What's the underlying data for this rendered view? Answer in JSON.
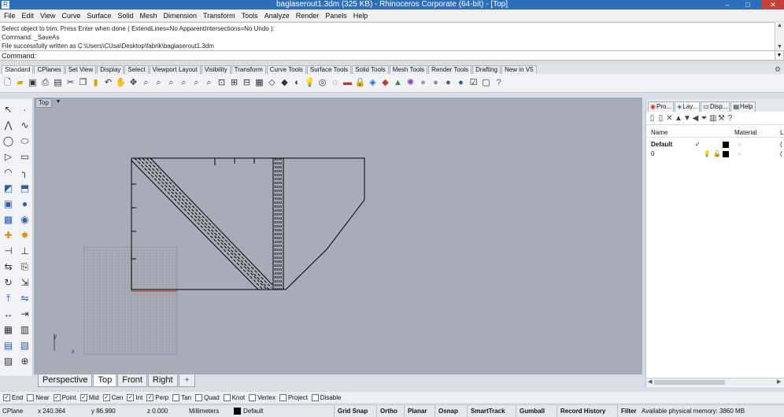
{
  "titlebar": {
    "title": "baglaserout1.3dm (325 KB) - Rhinoceros Corporate (64-bit) - [Top]",
    "min": "–",
    "max": "□",
    "close": "✕"
  },
  "menu": [
    "File",
    "Edit",
    "View",
    "Curve",
    "Surface",
    "Solid",
    "Mesh",
    "Dimension",
    "Transform",
    "Tools",
    "Analyze",
    "Render",
    "Panels",
    "Help"
  ],
  "history": [
    "Select object to trim. Press Enter when done ( ExtendLines=No  ApparentIntersections=No  Undo ):",
    "Command: _SaveAs",
    "File successfully written as C:\\Users\\CUsa\\Desktop\\fabrik\\baglaserout1.3dm"
  ],
  "command": {
    "label": "Command:",
    "value": ""
  },
  "toolbar_tabs": [
    "Standard",
    "CPlanes",
    "Set View",
    "Display",
    "Select",
    "Viewport Layout",
    "Visibility",
    "Transform",
    "Curve Tools",
    "Surface Tools",
    "Solid Tools",
    "Mesh Tools",
    "Render Tools",
    "Drafting",
    "New in V5"
  ],
  "toolbar_icons": [
    "new-file-icon",
    "open-file-icon",
    "save-icon",
    "print-icon",
    "import-icon",
    "cut-icon",
    "copy-icon",
    "paste-icon",
    "undo-icon",
    "pan-icon",
    "rotate-view-icon",
    "zoom-window-icon",
    "zoom-extents-icon",
    "zoom-selected-icon",
    "zoom-all-icon",
    "zoom-dynamic-icon",
    "zoom-selected2-icon",
    "viewport-maximize-icon",
    "four-viewports-icon",
    "cplane-icon",
    "grid-icon",
    "wireframe-icon",
    "shaded-icon",
    "rendered-icon",
    "lights-icon",
    "camera-icon",
    "select-icon",
    "car-icon",
    "lock-icon",
    "layer-icon",
    "properties-icon",
    "material-icon",
    "color-wheel-icon",
    "ghosted-icon",
    "sphere-render-icon",
    "render-icon",
    "render-blue-icon",
    "options-icon",
    "cube-icon",
    "help-icon"
  ],
  "viewport": {
    "label": "Top",
    "axis_y": "y",
    "axis_x": "x"
  },
  "viewport_tabs": [
    "Perspective",
    "Top",
    "Front",
    "Right",
    "+"
  ],
  "right_panel": {
    "tabs": [
      "Pro...",
      "Lay...",
      "Disp...",
      "Help"
    ],
    "columns": {
      "name": "Name",
      "material": "Material",
      "l": "L"
    },
    "layers": [
      {
        "name": "Default",
        "check": "✓",
        "material": "○",
        "end": "("
      },
      {
        "name": "0",
        "check": "",
        "material": "○",
        "end": "("
      }
    ]
  },
  "osnaps": [
    {
      "label": "End",
      "checked": true
    },
    {
      "label": "Near",
      "checked": false
    },
    {
      "label": "Point",
      "checked": true
    },
    {
      "label": "Mid",
      "checked": true
    },
    {
      "label": "Cen",
      "checked": true
    },
    {
      "label": "Int",
      "checked": true
    },
    {
      "label": "Perp",
      "checked": true
    },
    {
      "label": "Tan",
      "checked": false
    },
    {
      "label": "Quad",
      "checked": false
    },
    {
      "label": "Knot",
      "checked": false
    },
    {
      "label": "Vertex",
      "checked": false
    },
    {
      "label": "Project",
      "checked": false
    },
    {
      "label": "Disable",
      "checked": false
    }
  ],
  "status": {
    "cplane": "CPlane",
    "x": "x 240.364",
    "y": "y 86.990",
    "z": "z 0.000",
    "units": "Millimeters",
    "layer": "Default",
    "grid_snap": "Grid Snap",
    "ortho": "Ortho",
    "planar": "Planar",
    "osnap": "Osnap",
    "smarttrack": "SmartTrack",
    "gumball": "Gumball",
    "record_history": "Record History",
    "filter": "Filter",
    "memory": "Available physical memory: 3860 MB"
  }
}
